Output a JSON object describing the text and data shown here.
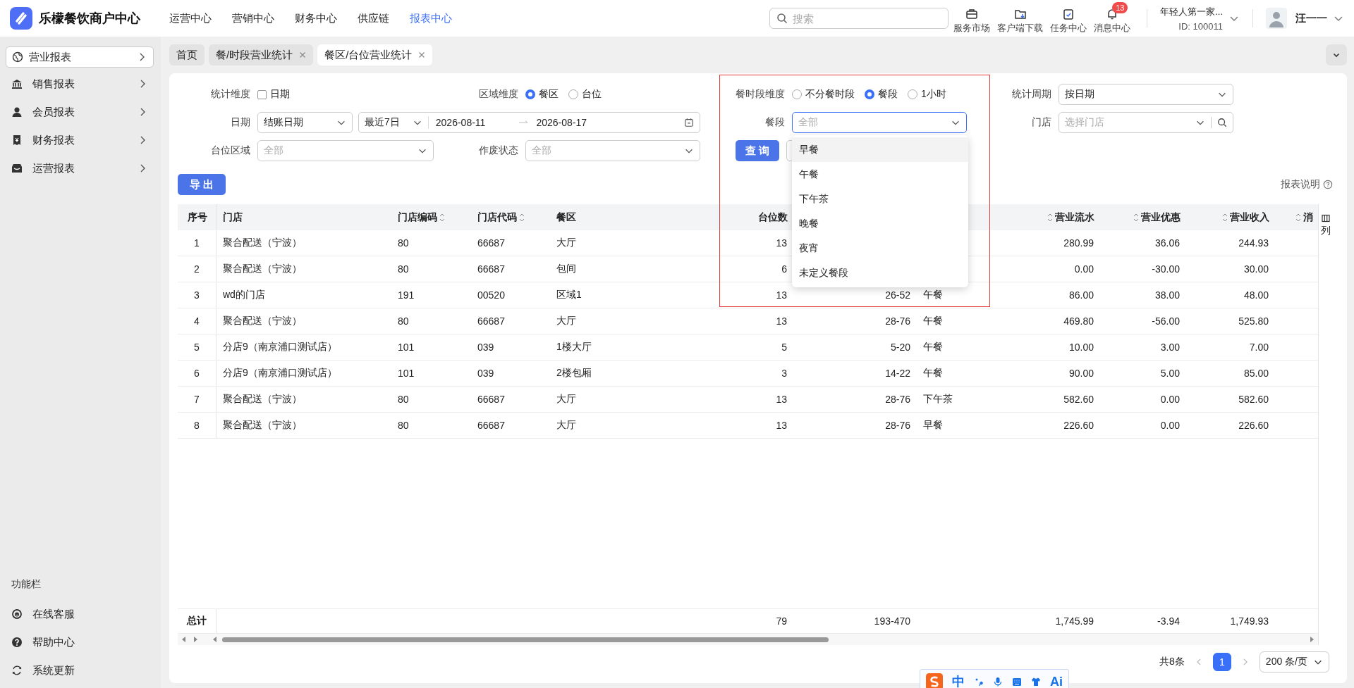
{
  "app": {
    "name": "乐檬餐饮商户中心"
  },
  "top_nav": [
    {
      "label": "运营中心",
      "selected": false
    },
    {
      "label": "营销中心",
      "selected": false
    },
    {
      "label": "财务中心",
      "selected": false
    },
    {
      "label": "供应链",
      "selected": false
    },
    {
      "label": "报表中心",
      "selected": true
    }
  ],
  "search": {
    "placeholder": "搜索"
  },
  "tools": [
    {
      "label": "服务市场",
      "kind": "market"
    },
    {
      "label": "客户端下载",
      "kind": "download"
    },
    {
      "label": "任务中心",
      "kind": "task"
    },
    {
      "label": "消息中心",
      "kind": "message",
      "badge": "13"
    }
  ],
  "account": {
    "name": "年轻人第一家...",
    "id": "ID: 100011"
  },
  "user": {
    "name": "汪一一"
  },
  "sidebar": {
    "items": [
      {
        "label": "营业报表",
        "kind": "globe",
        "selected": true
      },
      {
        "label": "销售报表",
        "kind": "bank",
        "selected": false
      },
      {
        "label": "会员报表",
        "kind": "user",
        "selected": false
      },
      {
        "label": "财务报表",
        "kind": "receipt",
        "selected": false
      },
      {
        "label": "运营报表",
        "kind": "shop",
        "selected": false
      }
    ],
    "section_title": "功能栏",
    "tools": [
      {
        "label": "在线客服",
        "kind": "service"
      },
      {
        "label": "帮助中心",
        "kind": "help"
      },
      {
        "label": "系统更新",
        "kind": "update"
      }
    ]
  },
  "tabs": [
    {
      "label": "首页",
      "closable": false,
      "selected": false
    },
    {
      "label": "餐/时段营业统计",
      "closable": true,
      "selected": false
    },
    {
      "label": "餐区/台位营业统计",
      "closable": true,
      "selected": true
    }
  ],
  "filters": {
    "stat_dimension": {
      "label": "统计维度",
      "options": [
        {
          "label": "日期",
          "checked": false
        }
      ]
    },
    "area_dimension": {
      "label": "区域维度",
      "options": [
        {
          "label": "餐区",
          "selected": true
        },
        {
          "label": "台位",
          "selected": false
        }
      ]
    },
    "meal_dimension": {
      "label": "餐时段维度",
      "options": [
        {
          "label": "不分餐时段",
          "selected": false
        },
        {
          "label": "餐段",
          "selected": true
        },
        {
          "label": "1小时",
          "selected": false
        }
      ]
    },
    "period": {
      "label": "统计周期",
      "value": "按日期"
    },
    "date": {
      "label": "日期",
      "type": "结账日期",
      "preset": "最近7日",
      "start": "2026-08-11",
      "end": "2026-08-17"
    },
    "meal_period": {
      "label": "餐段",
      "placeholder": "全部",
      "expanded": true,
      "options": [
        {
          "label": "早餐",
          "selected": true
        },
        {
          "label": "午餐",
          "selected": false
        },
        {
          "label": "下午茶",
          "selected": false
        },
        {
          "label": "晚餐",
          "selected": false
        },
        {
          "label": "夜宵",
          "selected": false
        },
        {
          "label": "未定义餐段",
          "selected": false
        }
      ]
    },
    "store": {
      "label": "门店",
      "placeholder": "选择门店"
    },
    "table_area": {
      "label": "台位区域",
      "placeholder": "全部"
    },
    "void_status": {
      "label": "作废状态",
      "placeholder": "全部"
    }
  },
  "actions": {
    "query": "查 询",
    "export": "导 出",
    "report_help": "报表说明"
  },
  "table": {
    "columns": [
      {
        "label": "序号",
        "sortable": false
      },
      {
        "label": "门店",
        "sortable": false
      },
      {
        "label": "门店编码",
        "sortable": true
      },
      {
        "label": "门店代码",
        "sortable": true
      },
      {
        "label": "餐区",
        "sortable": false
      },
      {
        "label": "台位数",
        "sortable": false
      },
      {},
      {},
      {
        "label": "营业流水",
        "sortable": true
      },
      {
        "label": "营业优惠",
        "sortable": true
      },
      {
        "label": "营业收入",
        "sortable": true
      },
      {
        "label": "消",
        "sortable": true
      }
    ],
    "rows": [
      {
        "no": "1",
        "store": "聚合配送（宁波）",
        "store_no": "80",
        "store_code": "66687",
        "area": "大厅",
        "tables": "13",
        "revenue": "280.99",
        "discount": "36.06",
        "income": "244.93"
      },
      {
        "no": "2",
        "store": "聚合配送（宁波）",
        "store_no": "80",
        "store_code": "66687",
        "area": "包间",
        "tables": "6",
        "revenue": "0.00",
        "discount": "-30.00",
        "income": "30.00"
      },
      {
        "no": "3",
        "store": "wd的门店",
        "store_no": "191",
        "store_code": "00520",
        "area": "区域1",
        "tables": "13",
        "column_7": "26-52",
        "column_8": "午餐",
        "revenue": "86.00",
        "discount": "38.00",
        "income": "48.00"
      },
      {
        "no": "4",
        "store": "聚合配送（宁波）",
        "store_no": "80",
        "store_code": "66687",
        "area": "大厅",
        "tables": "13",
        "column_7": "28-76",
        "column_8": "午餐",
        "revenue": "469.80",
        "discount": "-56.00",
        "income": "525.80"
      },
      {
        "no": "5",
        "store": "分店9（南京浦口测试店）",
        "store_no": "101",
        "store_code": "039",
        "area": "1楼大厅",
        "tables": "5",
        "column_7": "5-20",
        "column_8": "午餐",
        "revenue": "10.00",
        "discount": "3.00",
        "income": "7.00"
      },
      {
        "no": "6",
        "store": "分店9（南京浦口测试店）",
        "store_no": "101",
        "store_code": "039",
        "area": "2楼包厢",
        "tables": "3",
        "column_7": "14-22",
        "column_8": "午餐",
        "revenue": "90.00",
        "discount": "5.00",
        "income": "85.00"
      },
      {
        "no": "7",
        "store": "聚合配送（宁波）",
        "store_no": "80",
        "store_code": "66687",
        "area": "大厅",
        "tables": "13",
        "column_7": "28-76",
        "column_8": "下午茶",
        "revenue": "582.60",
        "discount": "0.00",
        "income": "582.60"
      },
      {
        "no": "8",
        "store": "聚合配送（宁波）",
        "store_no": "80",
        "store_code": "66687",
        "area": "大厅",
        "tables": "13",
        "column_7": "28-76",
        "column_8": "早餐",
        "revenue": "226.60",
        "discount": "0.00",
        "income": "226.60"
      }
    ],
    "total": {
      "no": "总计",
      "tables": "79",
      "column_7": "193-470",
      "revenue": "1,745.99",
      "discount": "-3.94",
      "income": "1,749.93"
    },
    "column_settings": "列"
  },
  "pagination": {
    "total": "共8条",
    "pages": [
      {
        "label": "1",
        "selected": true
      }
    ],
    "page_size": "200 条/页"
  },
  "ime_toolbar": {
    "mode": "中",
    "ai": "Ai"
  }
}
